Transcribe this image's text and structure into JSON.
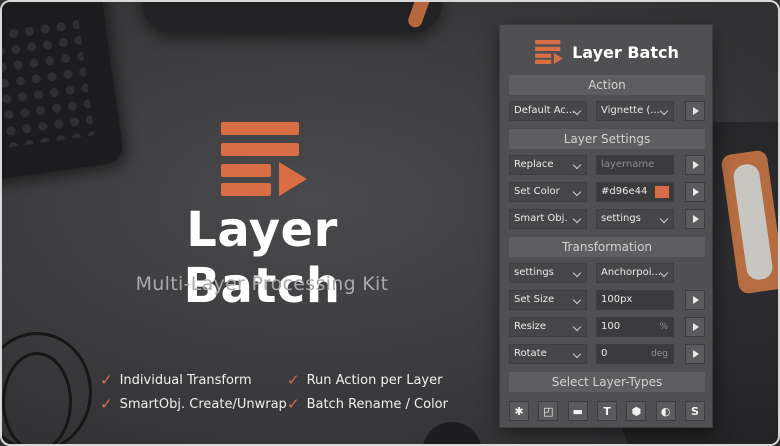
{
  "colors": {
    "accent": "#d96e44",
    "panel": "#505052",
    "background": "#3a3a3c"
  },
  "hero": {
    "title": "Layer Batch",
    "subtitle": "Multi-Layer Processing Kit",
    "logo_icon": "layer-batch-logo-icon"
  },
  "features": [
    "Individual Transform",
    "Run Action per Layer",
    "SmartObj. Create/Unwrap",
    "Batch Rename / Color"
  ],
  "panel": {
    "title": "Layer Batch",
    "sections": {
      "action": "Action",
      "layer_settings": "Layer Settings",
      "transformation": "Transformation",
      "select_types": "Select Layer-Types"
    },
    "action": {
      "set": "Default Ac...",
      "name": "Vignette (..."
    },
    "replace": {
      "mode": "Replace",
      "placeholder": "layername"
    },
    "color": {
      "mode": "Set Color",
      "value": "#d96e44"
    },
    "smart": {
      "mode": "Smart Obj.",
      "option": "settings"
    },
    "transform": {
      "mode": "settings",
      "anchor": "Anchorpoi..."
    },
    "size": {
      "mode": "Set Size",
      "value": "100px"
    },
    "resize": {
      "mode": "Resize",
      "value": "100",
      "unit": "%"
    },
    "rotate": {
      "mode": "Rotate",
      "value": "0",
      "unit": "deg"
    },
    "layer_types": [
      {
        "icon": "all-layers-icon",
        "glyph": "✱"
      },
      {
        "icon": "pixel-layer-icon",
        "glyph": "◰"
      },
      {
        "icon": "group-folder-icon",
        "glyph": "▬"
      },
      {
        "icon": "text-layer-icon",
        "glyph": "T"
      },
      {
        "icon": "shape-layer-icon",
        "glyph": "⬢"
      },
      {
        "icon": "adjustment-layer-icon",
        "glyph": "◐"
      },
      {
        "icon": "smart-object-icon",
        "glyph": "S"
      }
    ]
  }
}
